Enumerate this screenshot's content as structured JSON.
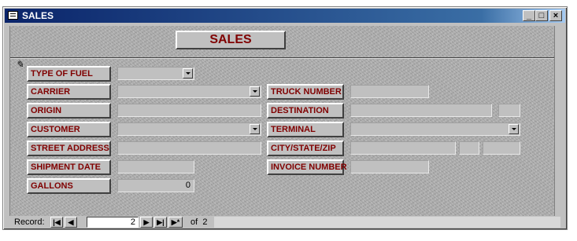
{
  "window": {
    "title": "SALES"
  },
  "header": {
    "button_label": "SALES"
  },
  "fields": {
    "type_of_fuel": {
      "label": "TYPE OF FUEL",
      "value": ""
    },
    "carrier": {
      "label": "CARRIER",
      "value": ""
    },
    "truck_number": {
      "label": "TRUCK NUMBER",
      "value": ""
    },
    "origin": {
      "label": "ORIGIN",
      "value": ""
    },
    "destination": {
      "label": "DESTINATION",
      "value": ""
    },
    "customer": {
      "label": "CUSTOMER",
      "value": ""
    },
    "terminal": {
      "label": "TERMINAL",
      "value": ""
    },
    "street_address": {
      "label": "STREET ADDRESS",
      "value": ""
    },
    "city_state_zip": {
      "label": "CITY/STATE/ZIP",
      "value": ""
    },
    "shipment_date": {
      "label": "SHIPMENT DATE",
      "value": ""
    },
    "invoice_number": {
      "label": "INVOICE NUMBER",
      "value": ""
    },
    "gallons": {
      "label": "GALLONS",
      "value": "0"
    }
  },
  "navigator": {
    "record_label": "Record:",
    "current_record": "2",
    "of_label": "of",
    "total_records": "2"
  }
}
